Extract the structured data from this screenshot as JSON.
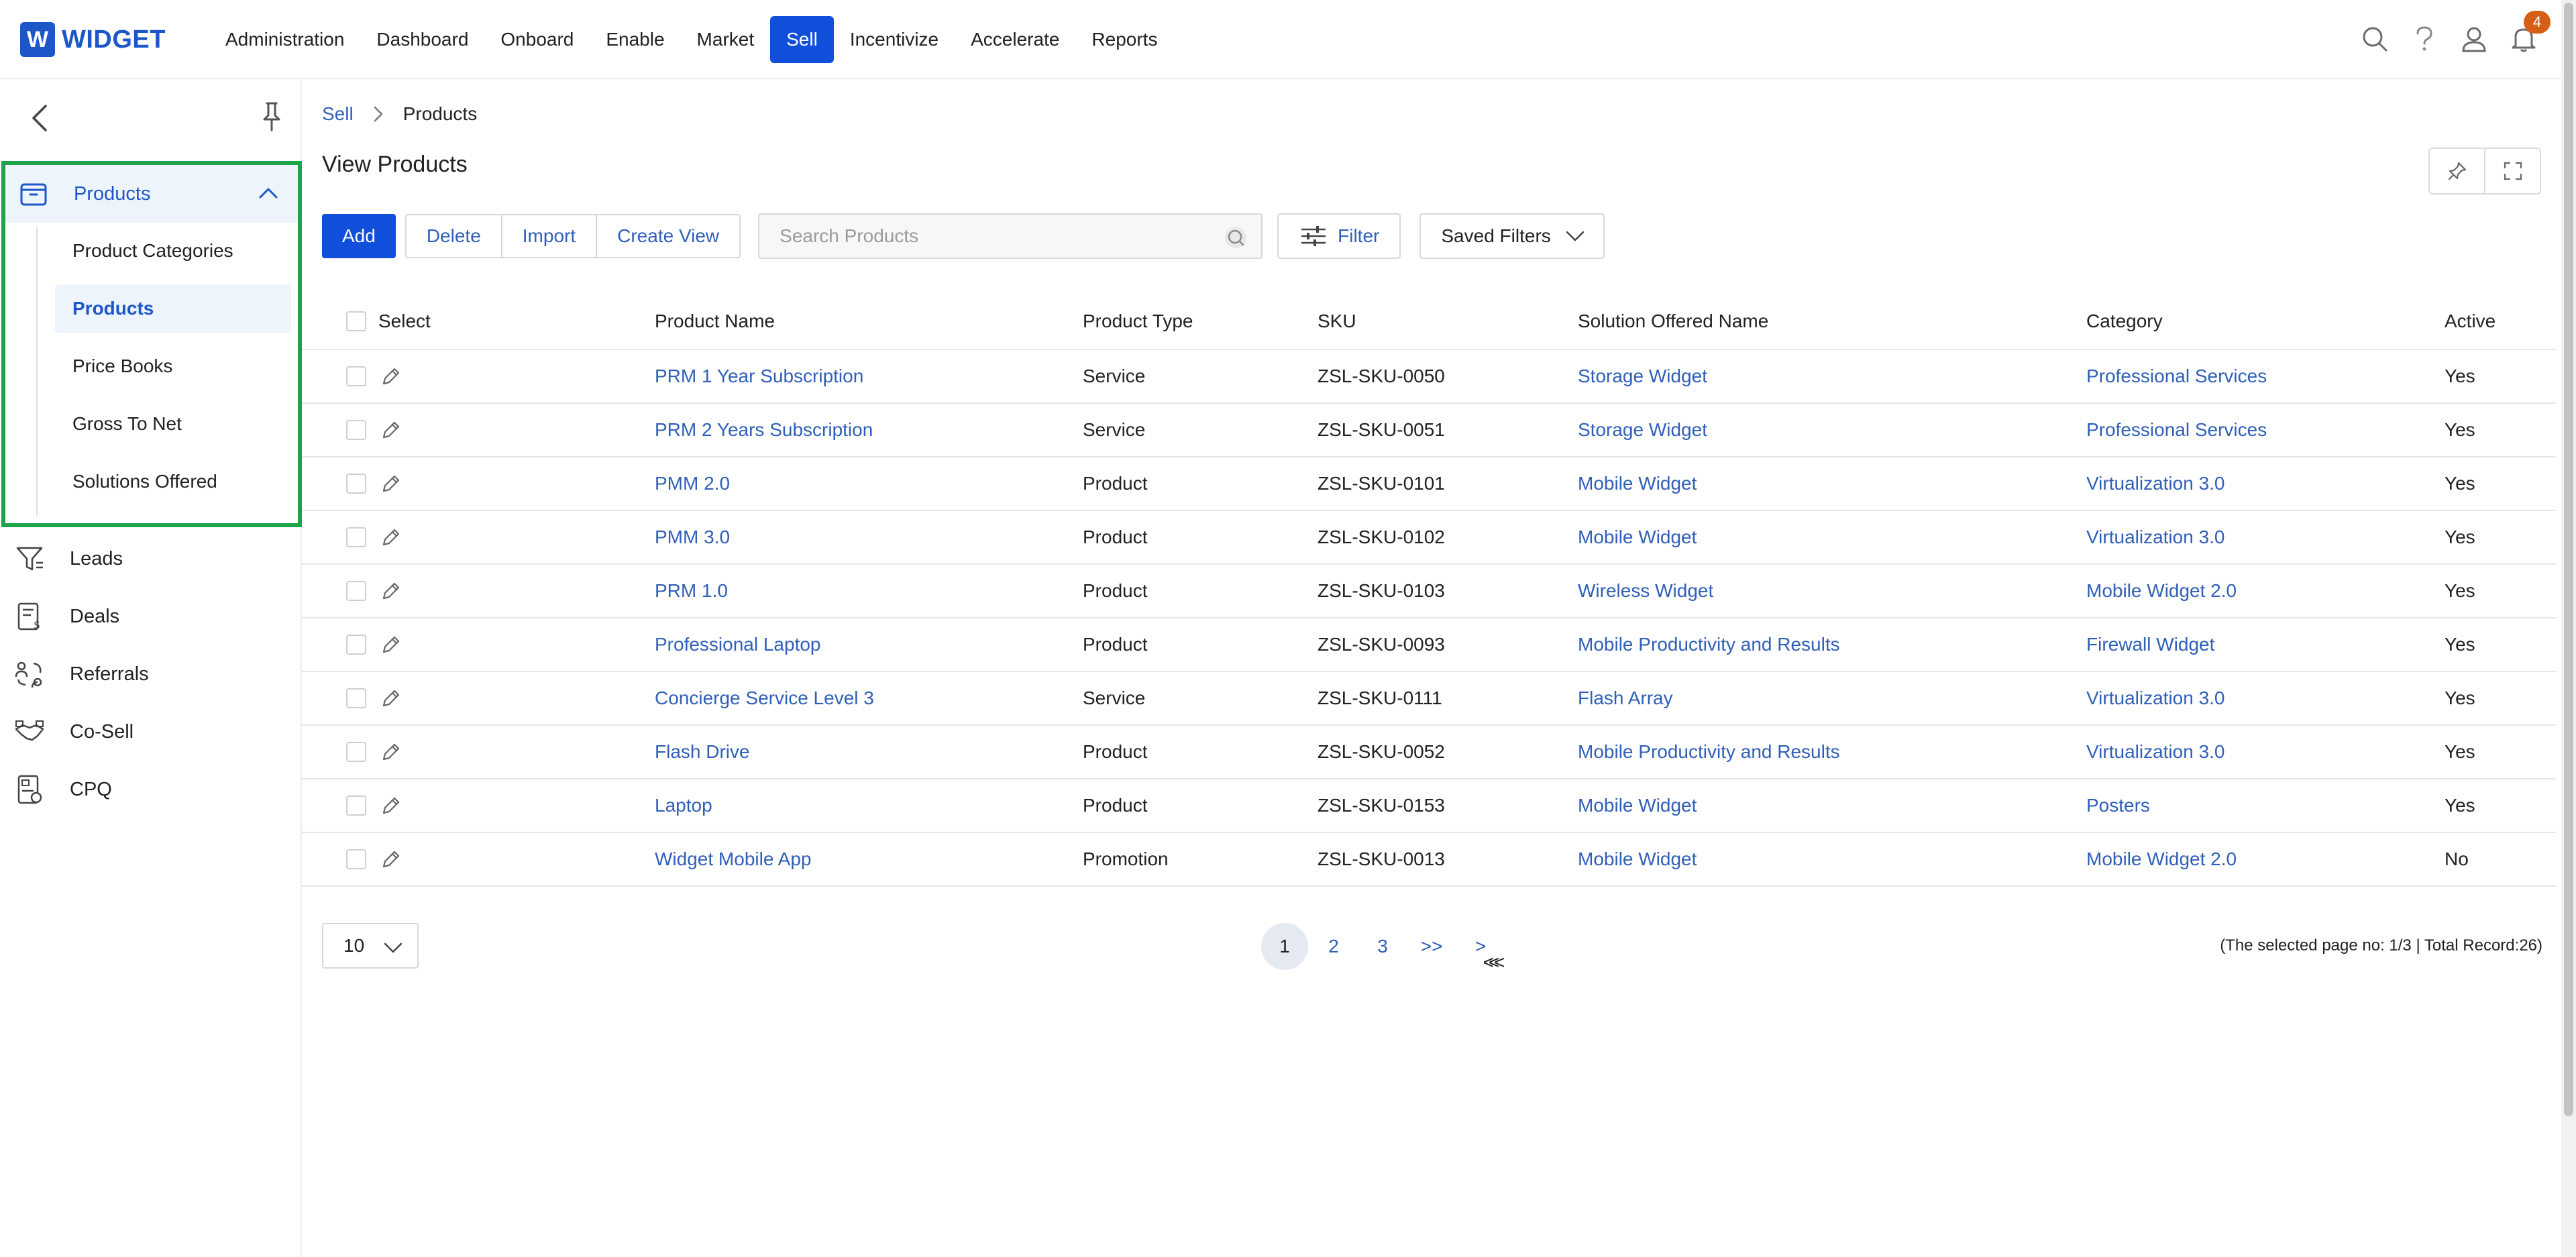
{
  "app": {
    "logo_letter": "W",
    "logo_text": "WIDGET",
    "brand_color": "#1d56c9",
    "accent_color": "#0f4fd9",
    "highlight_color": "#1ea34a"
  },
  "nav": {
    "items": [
      {
        "label": "Administration"
      },
      {
        "label": "Dashboard"
      },
      {
        "label": "Onboard"
      },
      {
        "label": "Enable"
      },
      {
        "label": "Market"
      },
      {
        "label": "Sell"
      },
      {
        "label": "Incentivize"
      },
      {
        "label": "Accelerate"
      },
      {
        "label": "Reports"
      }
    ],
    "active": "Sell",
    "notifications_count": "4",
    "icons": [
      "search-icon",
      "help-icon",
      "user-icon",
      "bell-icon"
    ]
  },
  "sidebar": {
    "group": {
      "label": "Products",
      "icon": "box-icon",
      "subitems": [
        {
          "label": "Product Categories"
        },
        {
          "label": "Products"
        },
        {
          "label": "Price Books"
        },
        {
          "label": "Gross To Net"
        },
        {
          "label": "Solutions Offered"
        }
      ],
      "active_subitem": "Products"
    },
    "items": [
      {
        "label": "Leads",
        "icon": "funnel-icon"
      },
      {
        "label": "Deals",
        "icon": "invoice-icon"
      },
      {
        "label": "Referrals",
        "icon": "referral-icon"
      },
      {
        "label": "Co-Sell",
        "icon": "handshake-icon"
      },
      {
        "label": "CPQ",
        "icon": "quote-icon"
      }
    ]
  },
  "breadcrumb": {
    "root": "Sell",
    "current": "Products"
  },
  "page": {
    "title": "View Products"
  },
  "toolbar": {
    "add": "Add",
    "delete": "Delete",
    "import": "Import",
    "create_view": "Create View",
    "search_placeholder": "Search Products",
    "filter": "Filter",
    "saved_filters": "Saved Filters"
  },
  "table": {
    "headers": {
      "select": "Select",
      "name": "Product Name",
      "type": "Product Type",
      "sku": "SKU",
      "solution": "Solution Offered Name",
      "category": "Category",
      "active": "Active"
    },
    "rows": [
      {
        "name": "PRM 1 Year Subscription",
        "type": "Service",
        "sku": "ZSL-SKU-0050",
        "solution": "Storage Widget",
        "category": "Professional Services",
        "active": "Yes"
      },
      {
        "name": "PRM 2 Years Subscription",
        "type": "Service",
        "sku": "ZSL-SKU-0051",
        "solution": "Storage Widget",
        "category": "Professional Services",
        "active": "Yes"
      },
      {
        "name": "PMM 2.0",
        "type": "Product",
        "sku": "ZSL-SKU-0101",
        "solution": "Mobile Widget",
        "category": "Virtualization 3.0",
        "active": "Yes"
      },
      {
        "name": "PMM 3.0",
        "type": "Product",
        "sku": "ZSL-SKU-0102",
        "solution": "Mobile Widget",
        "category": "Virtualization 3.0",
        "active": "Yes"
      },
      {
        "name": "PRM 1.0",
        "type": "Product",
        "sku": "ZSL-SKU-0103",
        "solution": "Wireless Widget",
        "category": "Mobile Widget 2.0",
        "active": "Yes"
      },
      {
        "name": "Professional Laptop",
        "type": "Product",
        "sku": "ZSL-SKU-0093",
        "solution": "Mobile Productivity and Results",
        "category": "Firewall Widget",
        "active": "Yes"
      },
      {
        "name": "Concierge Service Level 3",
        "type": "Service",
        "sku": "ZSL-SKU-0111",
        "solution": "Flash Array",
        "category": "Virtualization 3.0",
        "active": "Yes"
      },
      {
        "name": "Flash Drive",
        "type": "Product",
        "sku": "ZSL-SKU-0052",
        "solution": "Mobile Productivity and Results",
        "category": "Virtualization 3.0",
        "active": "Yes"
      },
      {
        "name": "Laptop",
        "type": "Product",
        "sku": "ZSL-SKU-0153",
        "solution": "Mobile Widget",
        "category": "Posters",
        "active": "Yes"
      },
      {
        "name": "Widget Mobile App",
        "type": "Promotion",
        "sku": "ZSL-SKU-0013",
        "solution": "Mobile Widget",
        "category": "Mobile Widget 2.0",
        "active": "No"
      }
    ]
  },
  "pagination": {
    "page_size": "10",
    "prev": "<",
    "first": "<<",
    "pages": [
      "1",
      "2",
      "3"
    ],
    "current_page": "1",
    "last": ">>",
    "next": ">",
    "info": "(The selected page no: 1/3 | Total Record:26)"
  }
}
